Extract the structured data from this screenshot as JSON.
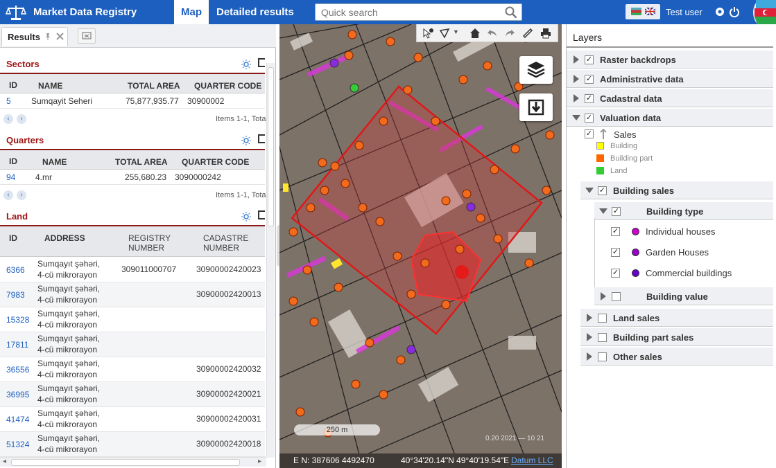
{
  "header": {
    "app_title": "Market Data Registry",
    "tabs": [
      {
        "label": "Map"
      },
      {
        "label": "Detailed results"
      }
    ],
    "search_placeholder": "Quick search",
    "user": "Test user"
  },
  "left_panel": {
    "tab_label": "Results",
    "sectors": {
      "title": "Sectors",
      "columns": [
        "ID",
        "NAME",
        "TOTAL AREA",
        "QUARTER CODE"
      ],
      "rows": [
        {
          "id": "5",
          "name": "Sumqayit Seheri",
          "area": "75,877,935.77",
          "code": "30900002"
        }
      ],
      "items_text": "Items 1-1, Tota"
    },
    "quarters": {
      "title": "Quarters",
      "columns": [
        "ID",
        "NAME",
        "TOTAL AREA",
        "QUARTER CODE"
      ],
      "rows": [
        {
          "id": "94",
          "name": "4.mr",
          "area": "255,680.23",
          "code": "3090000242"
        }
      ],
      "items_text": "Items 1-1, Tota"
    },
    "land": {
      "title": "Land",
      "columns": [
        "ID",
        "ADDRESS",
        "REGISTRY NUMBER",
        "CADASTRE NUMBER"
      ],
      "registry_line2": "NUMBER",
      "cadastre_line2": "NUMBER",
      "rows": [
        {
          "id": "6366",
          "addr1": "Sumqayıt şəhəri,",
          "addr2": "4-cü mikrorayon",
          "registry": "309011000707",
          "cadastre": "30900002420023"
        },
        {
          "id": "7983",
          "addr1": "Sumqayıt şəhəri,",
          "addr2": "4-cü mikrorayon",
          "registry": "",
          "cadastre": "30900002420013"
        },
        {
          "id": "15328",
          "addr1": "Sumqayıt şəhəri,",
          "addr2": "4-cü mikrorayon",
          "registry": "",
          "cadastre": ""
        },
        {
          "id": "17811",
          "addr1": "Sumqayıt şəhəri,",
          "addr2": "4-cü mikrorayon",
          "registry": "",
          "cadastre": ""
        },
        {
          "id": "36556",
          "addr1": "Sumqayıt şəhəri,",
          "addr2": "4-cü mikrorayon",
          "registry": "",
          "cadastre": "30900002420032"
        },
        {
          "id": "36995",
          "addr1": "Sumqayıt şəhəri,",
          "addr2": "4-cü mikrorayon",
          "registry": "",
          "cadastre": "30900002420021"
        },
        {
          "id": "41474",
          "addr1": "Sumqayıt şəhəri,",
          "addr2": "4-cü mikrorayon",
          "registry": "",
          "cadastre": "30900002420031"
        },
        {
          "id": "51324",
          "addr1": "Sumqayıt şəhəri,",
          "addr2": "4-cü mikrorayon",
          "registry": "",
          "cadastre": "30900002420018"
        }
      ]
    }
  },
  "map": {
    "scale_label": "250 m",
    "coords_en": "E N: 387606 4492470",
    "coords_latlon": "40°34'20.14\"N 49°40'19.54\"E",
    "attribution": "Datum LLC",
    "date_overlay": "0.20 2021 — 10 21"
  },
  "layers": {
    "title": "Layers",
    "groups": [
      {
        "label": "Raster backdrops",
        "checked": true
      },
      {
        "label": "Administrative data",
        "checked": true
      },
      {
        "label": "Cadastral data",
        "checked": true
      },
      {
        "label": "Valuation data",
        "checked": true
      }
    ],
    "sales": {
      "label": "Sales",
      "legend": [
        {
          "label": "Building",
          "color": "#ffff00"
        },
        {
          "label": "Building part",
          "color": "#ff6600"
        },
        {
          "label": "Land",
          "color": "#33cc33"
        }
      ]
    },
    "building_sales": "Building sales",
    "building_type": "Building type",
    "types": [
      {
        "label": "Individual houses",
        "color": "#cc00cc"
      },
      {
        "label": "Garden Houses",
        "color": "#9900cc"
      },
      {
        "label": "Commercial buildings",
        "color": "#6600cc"
      }
    ],
    "building_value": "Building value",
    "other_groups": [
      {
        "label": "Land sales"
      },
      {
        "label": "Building part sales"
      },
      {
        "label": "Other sales"
      }
    ]
  }
}
